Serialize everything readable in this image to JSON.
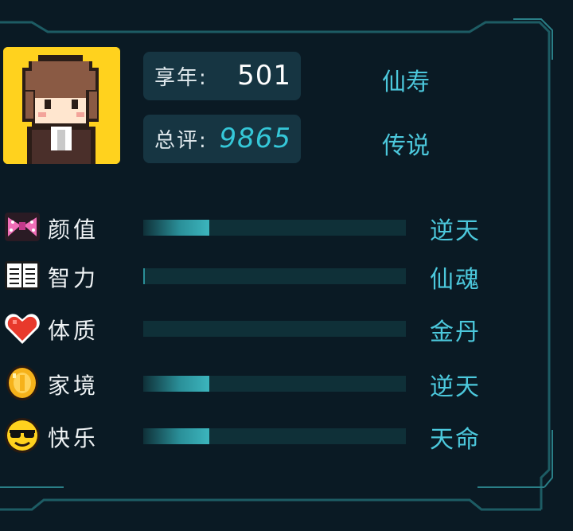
{
  "summary": {
    "age_label": "享年:",
    "age_value": "501",
    "age_rank": "仙寿",
    "score_label": "总评:",
    "score_value": "9865",
    "score_rank": "传说"
  },
  "attributes": [
    {
      "name": "颜值",
      "grade": "逆天",
      "icon": "bow-icon",
      "level": 0.25
    },
    {
      "name": "智力",
      "grade": "仙魂",
      "icon": "book-icon",
      "level": 0.0
    },
    {
      "name": "体质",
      "grade": "金丹",
      "icon": "heart-icon",
      "level": 0.0
    },
    {
      "name": "家境",
      "grade": "逆天",
      "icon": "coin-icon",
      "level": 0.25
    },
    {
      "name": "快乐",
      "grade": "天命",
      "icon": "sunglasses-face-icon",
      "level": 0.25
    }
  ],
  "colors": {
    "background": "#0a1a24",
    "accent": "#4cc8dc",
    "avatar_bg": "#ffd21e",
    "bar_track": "#0f3038"
  }
}
